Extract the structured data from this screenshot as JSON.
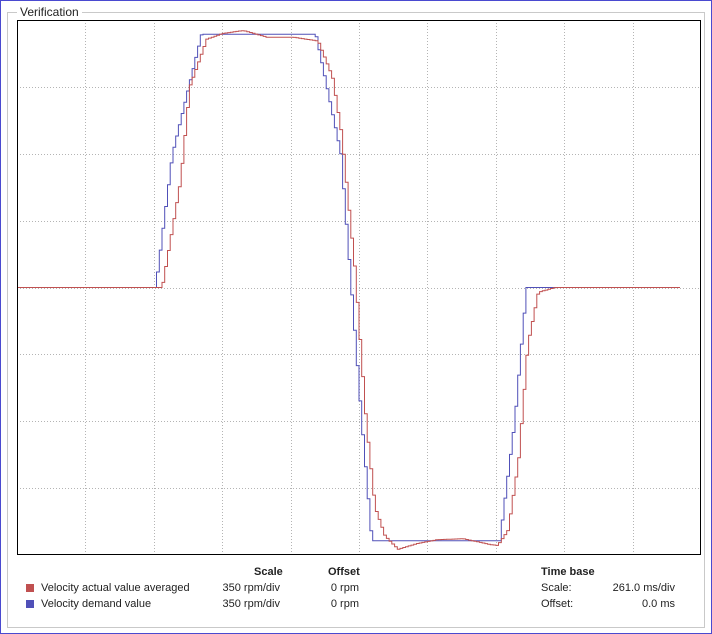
{
  "panel": {
    "title": "Verification"
  },
  "legend": {
    "headers": {
      "scale": "Scale",
      "offset": "Offset",
      "timebase": "Time base"
    },
    "channels": [
      {
        "name": "Velocity actual value averaged",
        "scale": "350 rpm/div",
        "offset": "0 rpm",
        "color": "#c05050"
      },
      {
        "name": "Velocity demand value",
        "scale": "350 rpm/div",
        "offset": "0 rpm",
        "color": "#5050b8"
      }
    ],
    "timebase": {
      "scale_label": "Scale:",
      "scale_value": "261.0 ms/div",
      "offset_label": "Offset:",
      "offset_value": "0.0 ms"
    }
  },
  "chart_data": {
    "type": "line",
    "x_unit": "ms",
    "y_unit": "rpm",
    "xlim": [
      0,
      2610
    ],
    "ylim": [
      -1400,
      1400
    ],
    "grid": true,
    "divisions": {
      "x": 10,
      "y": 8
    },
    "series": [
      {
        "name": "Velocity demand value",
        "color": "#5050b8",
        "stepped": true,
        "x": [
          0,
          525,
          589,
          700,
          1136,
          1232,
          1311,
          1350,
          1838,
          1895,
          1940,
          2530
        ],
        "y": [
          0,
          0,
          700,
          1325,
          1325,
          700,
          -700,
          -1325,
          -1325,
          -700,
          0,
          0
        ]
      },
      {
        "name": "Velocity actual value averaged",
        "color": "#c05050",
        "stepped": true,
        "x": [
          0,
          550,
          620,
          655,
          720,
          783,
          860,
          950,
          1000,
          1050,
          1145,
          1200,
          1235,
          1285,
          1328,
          1362,
          1400,
          1450,
          1523,
          1600,
          1700,
          1800,
          1830,
          1870,
          1910,
          1945,
          1985,
          2050,
          2530
        ],
        "y": [
          0,
          0,
          560,
          1050,
          1300,
          1330,
          1345,
          1310,
          1310,
          1310,
          1290,
          1100,
          800,
          100,
          -700,
          -1150,
          -1300,
          -1370,
          -1340,
          -1320,
          -1315,
          -1345,
          -1350,
          -1270,
          -900,
          -300,
          -25,
          0,
          0
        ]
      }
    ]
  }
}
